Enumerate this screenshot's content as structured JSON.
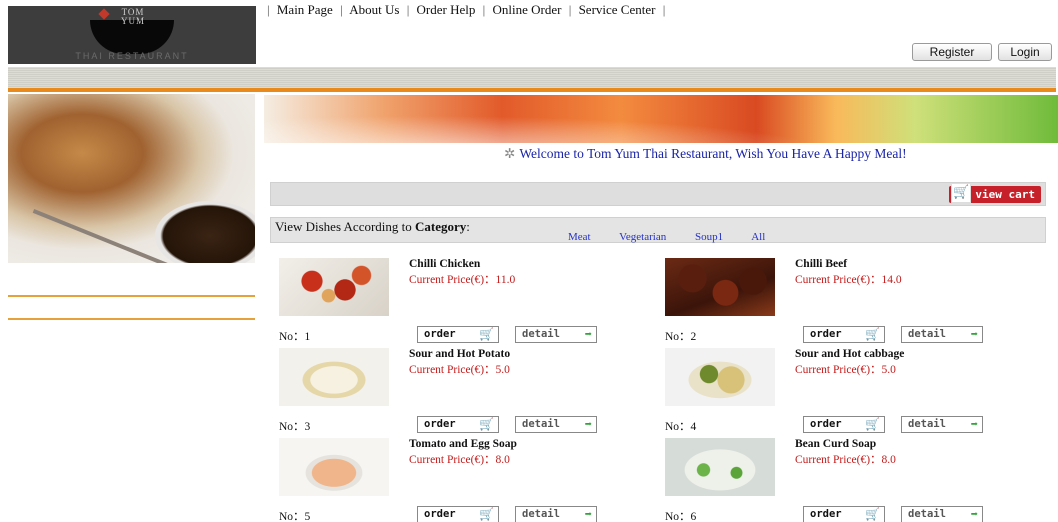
{
  "brand": {
    "logo_line1": "TOM",
    "logo_line2": "YUM",
    "logo_sub": "THAI RESTAURANT"
  },
  "header": {
    "register_label": "Register",
    "login_label": "Login"
  },
  "nav": {
    "separator": "|",
    "items": [
      "Main Page",
      "About Us",
      "Order Help",
      "Online Order",
      "Service Center"
    ]
  },
  "welcome": {
    "text": "Welcome to Tom Yum Thai Restaurant, Wish You Have A Happy Meal!"
  },
  "cart": {
    "label": "view cart",
    "icon": "shopping-cart-icon"
  },
  "category": {
    "label_prefix": "View Dishes According to ",
    "label_bold": "Category",
    "label_suffix": ":",
    "links": [
      "Meat",
      "Vegetarian",
      "Soup1",
      "All"
    ]
  },
  "buttons": {
    "order_label": "order",
    "detail_label": "detail"
  },
  "dishes": [
    {
      "name": "Chilli Chicken",
      "price": "Current Price(€)：11.0",
      "no": "No：1"
    },
    {
      "name": "Chilli Beef",
      "price": "Current Price(€)：14.0",
      "no": "No：2"
    },
    {
      "name": "Sour and Hot Potato",
      "price": "Current Price(€)：5.0",
      "no": "No：3"
    },
    {
      "name": "Sour and Hot cabbage",
      "price": "Current Price(€)：5.0",
      "no": "No：4"
    },
    {
      "name": "Tomato and Egg Soap",
      "price": "Current Price(€)：8.0",
      "no": "No：5"
    },
    {
      "name": "Bean Curd Soap",
      "price": "Current Price(€)：8.0",
      "no": "No：6"
    }
  ],
  "colors": {
    "accent_orange": "#e98a1c",
    "link_blue": "#2532c6",
    "price_red": "#c41a1a",
    "cart_red": "#c6202a"
  }
}
